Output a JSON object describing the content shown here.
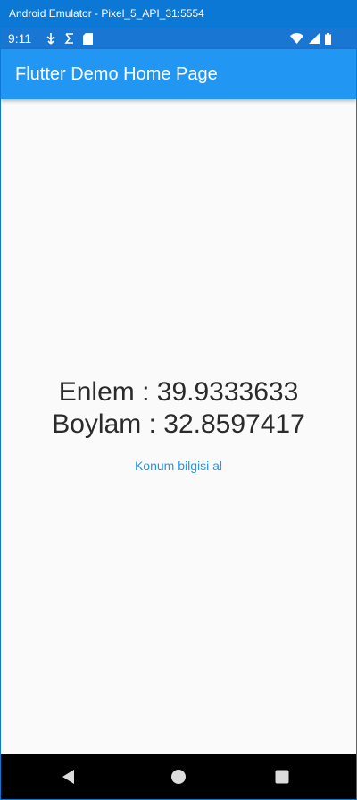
{
  "window": {
    "title": "Android Emulator - Pixel_5_API_31:5554"
  },
  "status_bar": {
    "time": "9:11",
    "left_icons": [
      "usb-debug-icon",
      "sync-icon",
      "sd-card-icon"
    ],
    "right_icons": [
      "wifi-icon",
      "signal-icon",
      "battery-icon"
    ]
  },
  "app_bar": {
    "title": "Flutter Demo Home Page"
  },
  "main": {
    "latitude_text": "Enlem : 39.9333633",
    "longitude_text": "Boylam : 32.8597417",
    "get_location_label": "Konum bilgisi al"
  },
  "nav_bar": {
    "buttons": [
      "back-icon",
      "home-icon",
      "recents-icon"
    ]
  },
  "colors": {
    "window_frame": "#0a78d4",
    "status_bar": "#1976d2",
    "app_bar": "#2196f3",
    "background": "#fafafa",
    "text": "#2b2b2b",
    "link": "#2196f3",
    "nav_bar": "#000000"
  }
}
